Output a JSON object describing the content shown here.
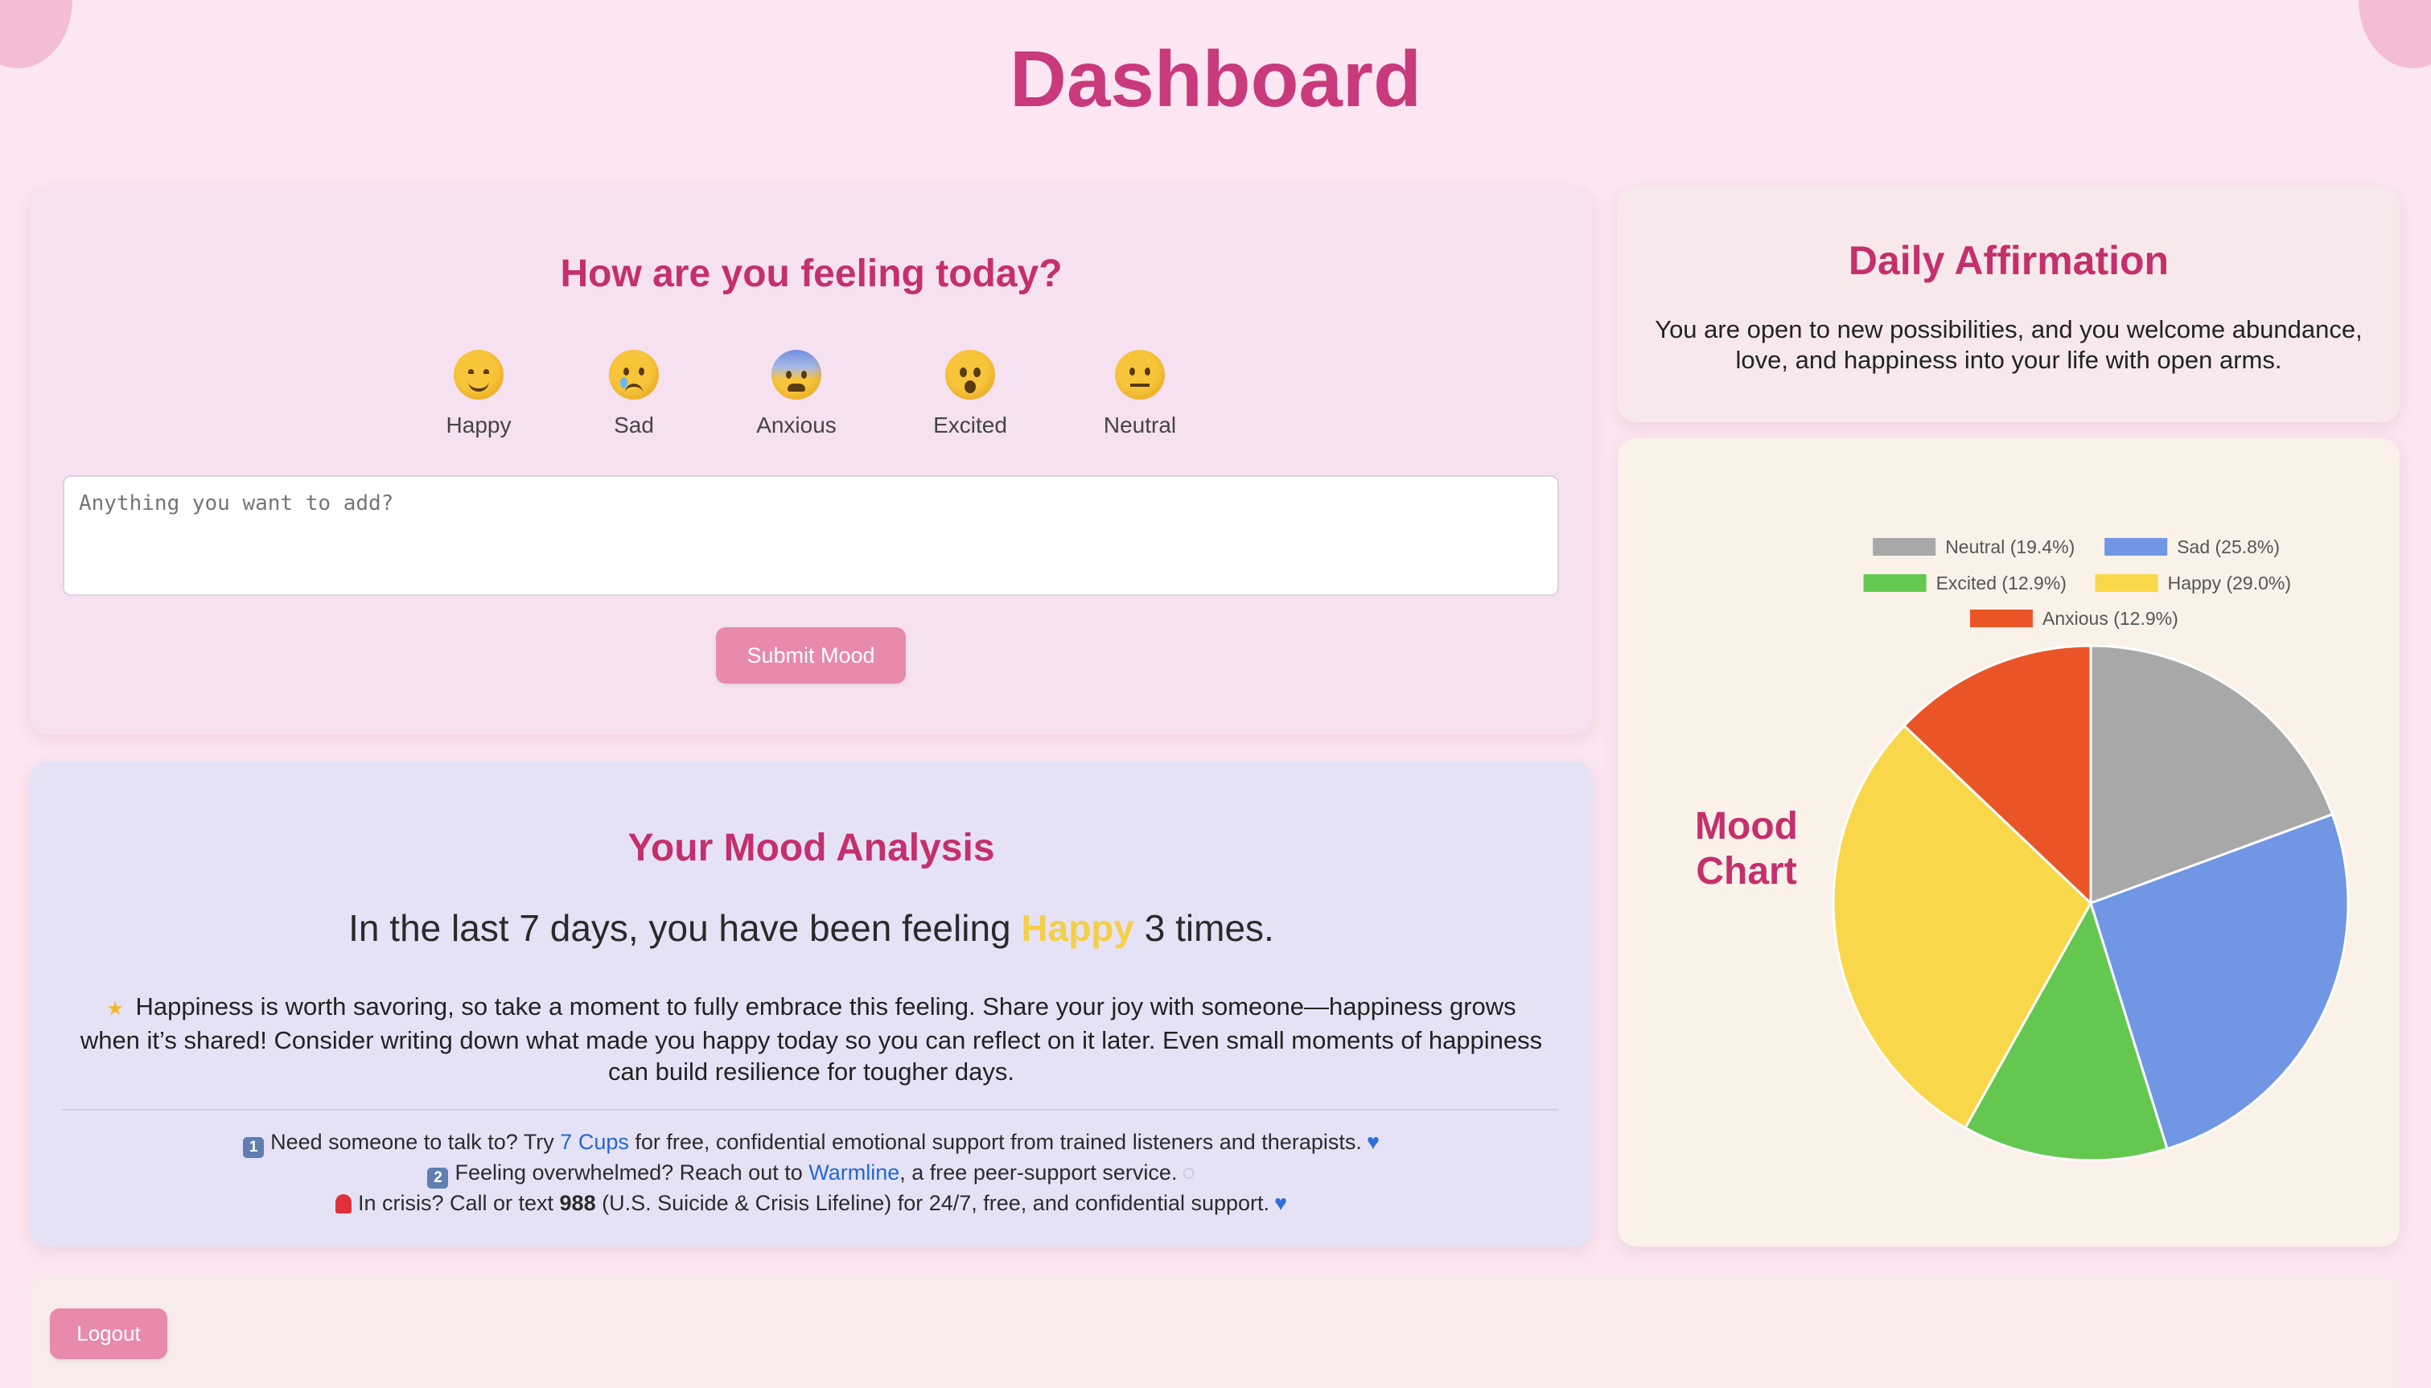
{
  "page": {
    "title": "Dashboard"
  },
  "mood_form": {
    "title": "How are you feeling today?",
    "moods": [
      {
        "label": "Happy",
        "icon": "smiling-face-icon"
      },
      {
        "label": "Sad",
        "icon": "crying-face-icon"
      },
      {
        "label": "Anxious",
        "icon": "anxious-face-icon"
      },
      {
        "label": "Excited",
        "icon": "astonished-face-icon"
      },
      {
        "label": "Neutral",
        "icon": "neutral-face-icon"
      }
    ],
    "note_placeholder": "Anything you want to add?",
    "submit_label": "Submit Mood"
  },
  "analysis": {
    "title": "Your Mood Analysis",
    "summary_prefix": "In the last 7 days, you have been feeling",
    "mood": "Happy",
    "summary_suffix": "3 times.",
    "advice_icon": "glowing-star-icon",
    "advice": "Happiness is worth savoring, so take a moment to fully embrace this feeling. Share your joy with someone—happiness grows when it’s shared! Consider writing down what made you happy today so you can reflect on it later. Even small moments of happiness can build resilience for tougher days.",
    "resources": [
      {
        "marker": "1",
        "before": "Need someone to talk to? Try",
        "link": "7 Cups",
        "after": "for free, confidential emotional support from trained listeners and therapists.",
        "end_icon": "blue-heart-icon"
      },
      {
        "marker": "2",
        "before": "Feeling overwhelmed? Reach out to",
        "link": "Warmline",
        "after": ", a free peer-support service.",
        "end_icon": "speech-bubble-icon"
      },
      {
        "marker_icon": "siren-icon",
        "before": "In crisis? Call or text",
        "bold": "988",
        "after": "(U.S. Suicide & Crisis Lifeline) for 24/7, free, and confidential support.",
        "end_icon": "blue-heart-icon"
      }
    ]
  },
  "affirmation": {
    "title": "Daily Affirmation",
    "text": "You are open to new possibilities, and you welcome abundance, love, and happiness into your life with open arms."
  },
  "chart_data": {
    "type": "pie",
    "title": "Mood Chart",
    "legend_position": "top",
    "slices": [
      {
        "label": "Neutral (19.4%)",
        "value": 19.4,
        "color": "#a8a8a8"
      },
      {
        "label": "Sad (25.8%)",
        "value": 25.8,
        "color": "#7096e4"
      },
      {
        "label": "Excited (12.9%)",
        "value": 12.9,
        "color": "#64c850"
      },
      {
        "label": "Happy (29.0%)",
        "value": 29.0,
        "color": "#f8d84a"
      },
      {
        "label": "Anxious (12.9%)",
        "value": 12.9,
        "color": "#ea5528"
      }
    ]
  },
  "footer": {
    "logout_label": "Logout"
  }
}
